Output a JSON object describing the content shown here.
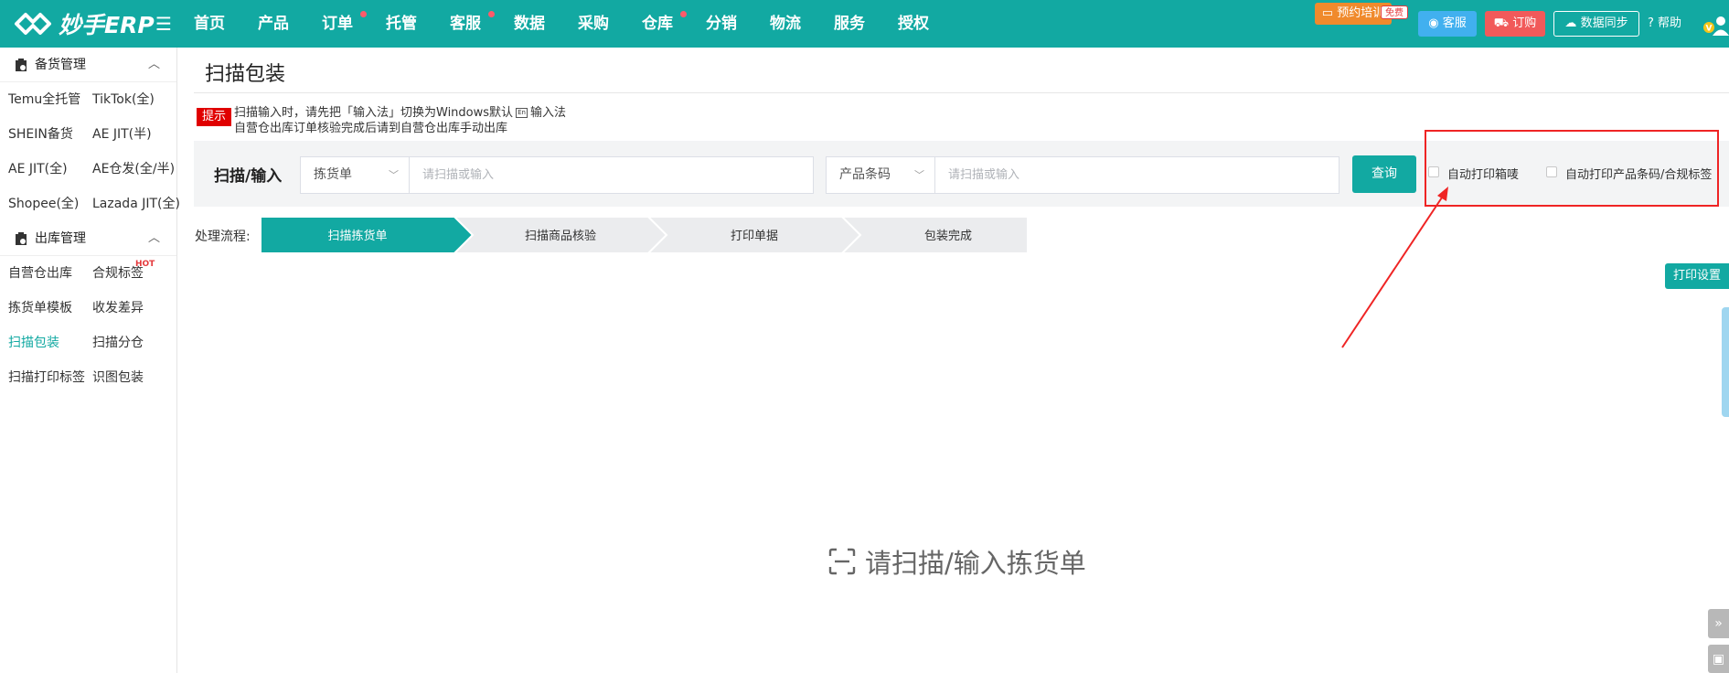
{
  "brand": {
    "name": "妙手ERP"
  },
  "nav": {
    "items": [
      {
        "label": "首页",
        "dot": false
      },
      {
        "label": "产品",
        "dot": false
      },
      {
        "label": "订单",
        "dot": true
      },
      {
        "label": "托管",
        "dot": false
      },
      {
        "label": "客服",
        "dot": true
      },
      {
        "label": "数据",
        "dot": false
      },
      {
        "label": "采购",
        "dot": false
      },
      {
        "label": "仓库",
        "dot": true
      },
      {
        "label": "分销",
        "dot": false
      },
      {
        "label": "物流",
        "dot": false
      },
      {
        "label": "服务",
        "dot": false
      },
      {
        "label": "授权",
        "dot": false
      }
    ]
  },
  "header_right": {
    "training": "预约培训",
    "free_tag": "免费",
    "support": "客服",
    "order": "订购",
    "sync": "数据同步",
    "help": "帮助"
  },
  "sidebar": {
    "group1": {
      "title": "备货管理",
      "rows": [
        [
          "Temu全托管",
          "TikTok(全)"
        ],
        [
          "SHEIN备货",
          "AE JIT(半)"
        ],
        [
          "AE JIT(全)",
          "AE仓发(全/半)"
        ],
        [
          "Shopee(全)",
          "Lazada JIT(全)"
        ]
      ]
    },
    "group2": {
      "title": "出库管理",
      "rows": [
        [
          "自营仓出库",
          "合规标签"
        ],
        [
          "拣货单模板",
          "收发差异"
        ],
        [
          "扫描包装",
          "扫描分仓"
        ],
        [
          "扫描打印标签",
          "识图包装"
        ]
      ],
      "hot_label": "HOT",
      "active": "扫描包装"
    }
  },
  "page": {
    "title": "扫描包装",
    "tip_tag": "提示",
    "tip_line1_a": "扫描输入时，请先把「输入法」切换为Windows默认",
    "tip_line1_icon": "En",
    "tip_line1_b": "输入法",
    "tip_line2": "自营仓出库订单核验完成后请到自营仓出库手动出库"
  },
  "scan": {
    "label": "扫描/输入",
    "select1": "拣货单",
    "input1_placeholder": "请扫描或输入",
    "select2": "产品条码",
    "input2_placeholder": "请扫描或输入",
    "query": "查询",
    "auto_print_box": "自动打印箱唛",
    "auto_print_barcode": "自动打印产品条码/合规标签"
  },
  "flow": {
    "label": "处理流程:",
    "steps": [
      "扫描拣货单",
      "扫描商品核验",
      "打印单据",
      "包装完成"
    ],
    "active_index": 0
  },
  "print_settings": "打印设置",
  "empty_hint": "请扫描/输入拣货单",
  "colors": {
    "brand": "#12a9a2",
    "highlight": "#ef2424"
  }
}
